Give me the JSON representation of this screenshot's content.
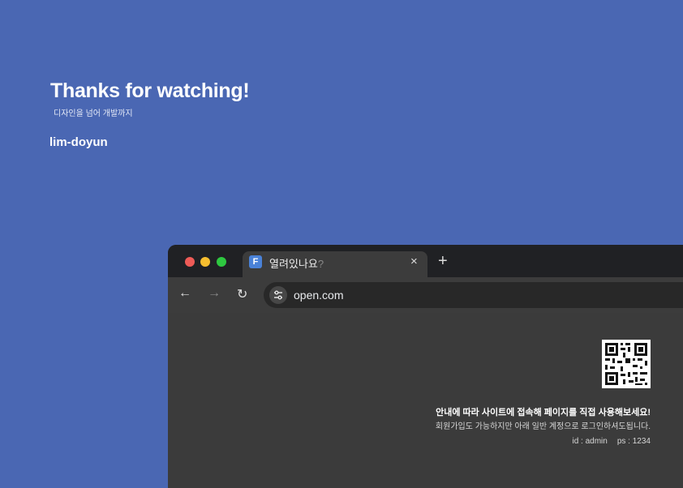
{
  "slide": {
    "headline": "Thanks for watching!",
    "subheadline": "디자인을 넘어 개발까지",
    "author": "lim-doyun",
    "background_color": "#4a67b3"
  },
  "browser": {
    "window_controls": [
      "close",
      "minimize",
      "maximize"
    ],
    "tab": {
      "favicon_letter": "F",
      "title": "열려있나요",
      "title_suffix": "?",
      "close_label": "×"
    },
    "new_tab_label": "+",
    "nav": {
      "back_icon": "←",
      "forward_icon": "→",
      "reload_icon": "↻"
    },
    "address": {
      "url": "open.com",
      "site_info_icon": "tune-icon"
    },
    "page": {
      "qr_icon": "qr-code",
      "notice_bold": "안내에 따라 사이트에 접속해 페이지를 직접 사용해보세요!",
      "notice": "회원가입도 가능하지만 아래 일반 계정으로 로그인하셔도됩니다.",
      "credentials": {
        "id": "id : admin",
        "ps": "ps : 1234"
      }
    }
  }
}
